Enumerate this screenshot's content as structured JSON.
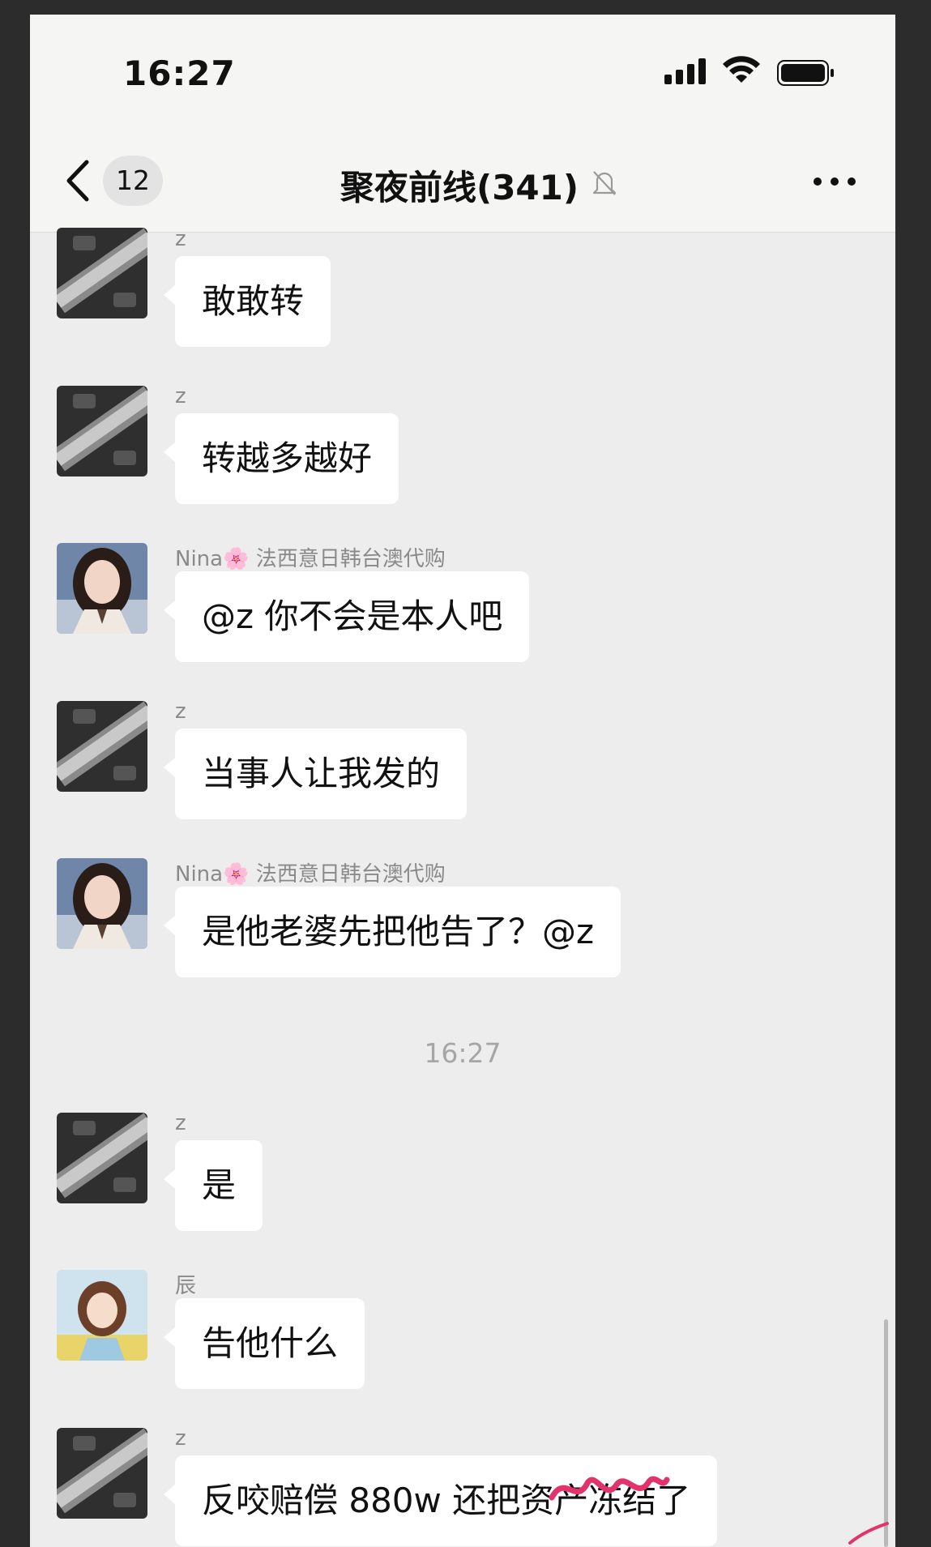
{
  "status_bar": {
    "time": "16:27"
  },
  "header": {
    "unread_count": "12",
    "title": "聚夜前线(341)",
    "muted": true
  },
  "messages": [
    {
      "sender": "z",
      "text": "敢敢转",
      "avatar": "keyboard-avatar"
    },
    {
      "sender": "z",
      "text": "转越多越好",
      "avatar": "keyboard-avatar"
    },
    {
      "sender": "Nina🌸 法西意日韩台澳代购",
      "text": "@z 你不会是本人吧",
      "avatar": "woman-avatar"
    },
    {
      "sender": "z",
      "text": "当事人让我发的",
      "avatar": "keyboard-avatar"
    },
    {
      "sender": "Nina🌸 法西意日韩台澳代购",
      "text": "是他老婆先把他告了？@z",
      "avatar": "woman-avatar"
    },
    {
      "sender": "z",
      "text": "是",
      "avatar": "keyboard-avatar"
    },
    {
      "sender": "辰",
      "text": "告他什么",
      "avatar": "girl-avatar"
    },
    {
      "sender": "z",
      "text": "反咬赔偿 880w 还把资产冻结了",
      "avatar": "keyboard-avatar"
    }
  ],
  "timestamp": "16:27",
  "colors": {
    "background": "#ededed",
    "bubble": "#ffffff",
    "sender_text": "#8a8a8a",
    "overlay_scribble": "#e2336b"
  }
}
